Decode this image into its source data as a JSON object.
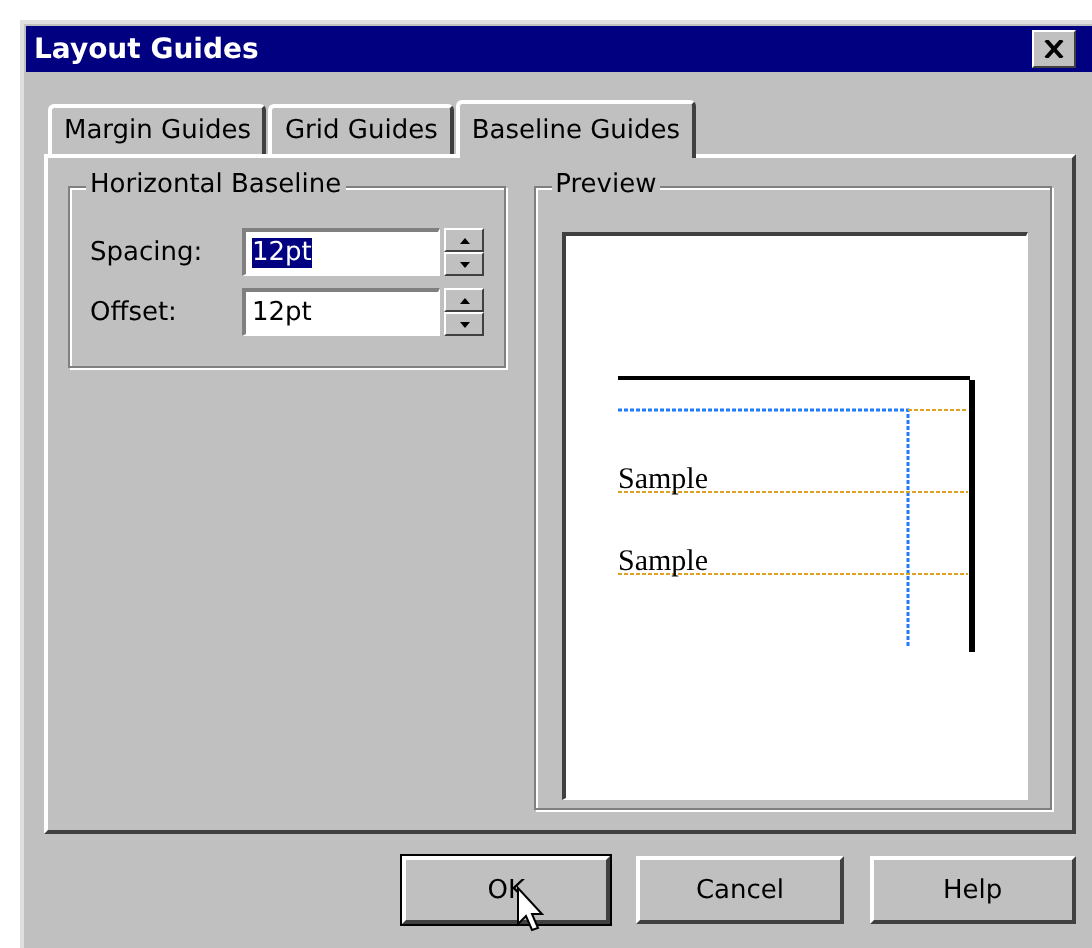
{
  "window": {
    "title": "Layout Guides"
  },
  "tabs": [
    {
      "label": "Margin Guides",
      "selected": false
    },
    {
      "label": "Grid Guides",
      "selected": false
    },
    {
      "label": "Baseline Guides",
      "selected": true
    }
  ],
  "horizontal_baseline": {
    "title": "Horizontal Baseline",
    "fields": [
      {
        "label": "Spacing:",
        "value": "12pt",
        "text_selected": true
      },
      {
        "label": "Offset:",
        "value": "12pt",
        "text_selected": false
      }
    ]
  },
  "preview": {
    "title": "Preview",
    "samples": [
      "Sample",
      "Sample"
    ]
  },
  "buttons": [
    {
      "label": "OK",
      "default": true
    },
    {
      "label": "Cancel",
      "default": false
    },
    {
      "label": "Help",
      "default": false
    }
  ]
}
